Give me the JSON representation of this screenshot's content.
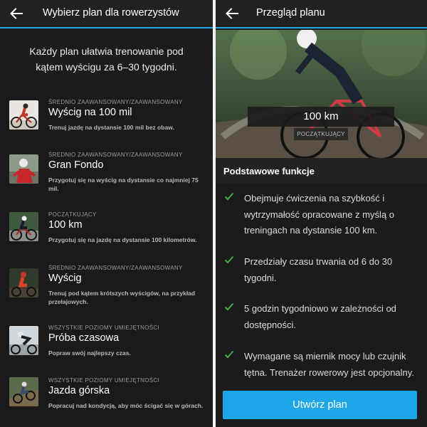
{
  "left_screen": {
    "title": "Wybierz plan dla rowerzystów",
    "intro": "Każdy plan ułatwia trenowanie pod kątem wyścigu za 6–30 tygodni.",
    "plans": [
      {
        "level": "ŚREDNIO ZAAWANSOWANY/ZAAWANSOWANY",
        "name": "Wyścig na 100 mil",
        "description": "Trenuj jazdę na dystansie 100 mil bez obaw."
      },
      {
        "level": "ŚREDNIO ZAAWANSOWANY/ZAAWANSOWANY",
        "name": "Gran Fondo",
        "description": "Przygotuj się na wyścig na dystansie co najmniej 75 mil."
      },
      {
        "level": "POCZĄTKUJĄCY",
        "name": "100 km",
        "description": "Przygotuj się na jazdę na dystansie 100 kilometrów."
      },
      {
        "level": "ŚREDNIO ZAAWANSOWANY/ZAAWANSOWANY",
        "name": "Wyścig",
        "description": "Trenuj pod kątem krótszych wyścigów, na przykład przełajowych."
      },
      {
        "level": "WSZYSTKIE POZIOMY UMIEJĘTNOŚCI",
        "name": "Próba czasowa",
        "description": "Popraw swój najlepszy czas."
      },
      {
        "level": "WSZYSTKIE POZIOMY UMIEJĘTNOŚCI",
        "name": "Jazda górska",
        "description": "Popracuj nad kondycją, aby móc ścigać się w górach."
      }
    ]
  },
  "right_screen": {
    "title": "Przegląd planu",
    "hero_distance": "100 km",
    "hero_level": "POCZĄTKUJĄCY",
    "features_title": "Podstawowe funkcje",
    "features": [
      "Obejmuje ćwiczenia na szybkość i wytrzymałość opracowane z myślą o treningach na dystansie 100 km.",
      "Przedziały czasu trwania od 6 do 30 tygodni.",
      "5 godzin tygodniowo w zależności od dostępności.",
      "Wymagane są miernik mocy lub czujnik tętna. Trenażer rowerowy jest opcjonalny."
    ],
    "cta_label": "Utwórz plan"
  },
  "colors": {
    "accent": "#1ea7e8",
    "check": "#3fae49",
    "background": "#1c1c1c"
  },
  "icons": {
    "back": "arrow-left-icon",
    "check": "check-icon"
  }
}
